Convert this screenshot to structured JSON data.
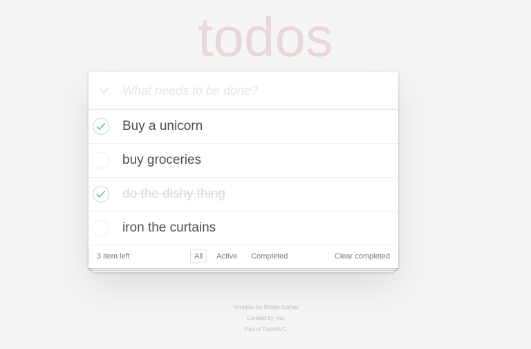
{
  "app": {
    "title": "todos"
  },
  "new_todo": {
    "placeholder": "What needs to be done?",
    "value": ""
  },
  "todos": [
    {
      "label": "Buy a unicorn",
      "completed": true
    },
    {
      "label": "buy groceries",
      "completed": false
    },
    {
      "label": "do the dishy thing",
      "completed": true
    },
    {
      "label": "iron the curtains",
      "completed": false
    }
  ],
  "footer": {
    "count_text": "3 item left",
    "filters": [
      {
        "label": "All",
        "selected": true
      },
      {
        "label": "Active",
        "selected": false
      },
      {
        "label": "Completed",
        "selected": false
      }
    ],
    "clear_completed_label": "Clear completed"
  },
  "info": {
    "line1": "Template by Sindre Sorhus",
    "line2": "Created by you",
    "line3": "Part of TodoMVC"
  },
  "colors": {
    "title": "#eadadc",
    "check": "#5dc2af",
    "selected_filter_border": "#efd6d6"
  },
  "icons": {
    "toggle_all": "chevron-down-icon",
    "check": "checkmark-icon"
  }
}
